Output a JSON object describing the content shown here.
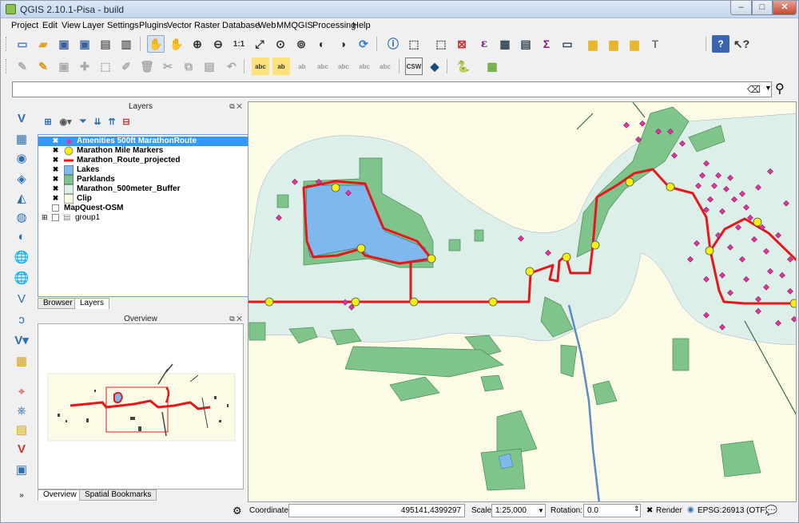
{
  "window": {
    "title": "QGIS 2.10.1-Pisa - build",
    "min": "–",
    "max": "□",
    "close": "✕"
  },
  "menu": [
    "Project",
    "Edit",
    "View",
    "Layer",
    "Settings",
    "Plugins",
    "Vector",
    "Raster",
    "Database",
    "Web",
    "MMQGIS",
    "Processing",
    "Help"
  ],
  "toolbar": {
    "row1_icons": [
      "new-project",
      "open-project",
      "save-project",
      "save-as",
      "print-composer",
      "compose-manager",
      "pan-map",
      "pan-to-selection",
      "zoom-in",
      "zoom-out",
      "zoom-native",
      "zoom-full",
      "zoom-to-selection",
      "zoom-to-layer",
      "zoom-last",
      "zoom-next",
      "refresh",
      "identify",
      "select",
      "select-by-location",
      "deselect",
      "field-calculator",
      "attribute-table",
      "statistics",
      "measure",
      "map-tips",
      "bookmark",
      "annotation",
      "text-annotation",
      "help",
      "whats-this"
    ],
    "row2_icons": [
      "current-edits",
      "toggle-editing",
      "save-edits",
      "add-feature",
      "move-feature",
      "delete-selected",
      "cut-features",
      "copy-features",
      "paste-features",
      "label-toolbar-1",
      "label-toolbar-2",
      "label-toolbar-3",
      "label-toolbar-4",
      "label-toolbar-5",
      "label-toolbar-6",
      "label-toolbar-7",
      "csw",
      "metasearch",
      "python-console",
      "openlayers-plugin"
    ],
    "csw_label": "CSW"
  },
  "locator": {
    "value": "",
    "placeholder": ""
  },
  "layers_panel": {
    "title": "Layers",
    "layers": [
      {
        "name": "Amenities 500ft MarathonRoute",
        "checked": true,
        "selected": true,
        "symbol": "point-pink"
      },
      {
        "name": "Marathon Mile Markers",
        "checked": true,
        "selected": false,
        "symbol": "point-yellow"
      },
      {
        "name": "Marathon_Route_projected",
        "checked": true,
        "selected": false,
        "symbol": "line-red"
      },
      {
        "name": "Lakes",
        "checked": true,
        "selected": false,
        "symbol": "poly-blue"
      },
      {
        "name": "Parklands",
        "checked": true,
        "selected": false,
        "symbol": "poly-green"
      },
      {
        "name": "Marathon_500meter_Buffer",
        "checked": true,
        "selected": false,
        "symbol": "poly-lightblue"
      },
      {
        "name": "Clip",
        "checked": true,
        "selected": false,
        "symbol": "poly-cream"
      },
      {
        "name": "MapQuest-OSM",
        "checked": false,
        "selected": false,
        "symbol": "none"
      },
      {
        "name": "group1",
        "checked": false,
        "selected": false,
        "symbol": "group"
      }
    ],
    "tabs": [
      "Browser",
      "Layers"
    ],
    "active_tab": "Layers"
  },
  "overview_panel": {
    "title": "Overview",
    "tabs": [
      "Overview",
      "Spatial Bookmarks"
    ],
    "active_tab": "Overview"
  },
  "status": {
    "coordinate_label": "Coordinate:",
    "coordinate_value": "495141,4399297",
    "scale_label": "Scale",
    "scale_value": "1:25,000",
    "rotation_label": "Rotation:",
    "rotation_value": "0.0",
    "render_label": "Render",
    "render_checked": true,
    "crs_label": "EPSG:26913 (OTF)"
  },
  "colors": {
    "route": "#e8161b",
    "buffer": "#dcefe8",
    "parkland": "#7fc48a",
    "lake": "#7fb8ec",
    "clip": "#fcfbe6",
    "amenity": "#e0359e",
    "marker": "#f6f10c",
    "selection": "#3399ff"
  }
}
